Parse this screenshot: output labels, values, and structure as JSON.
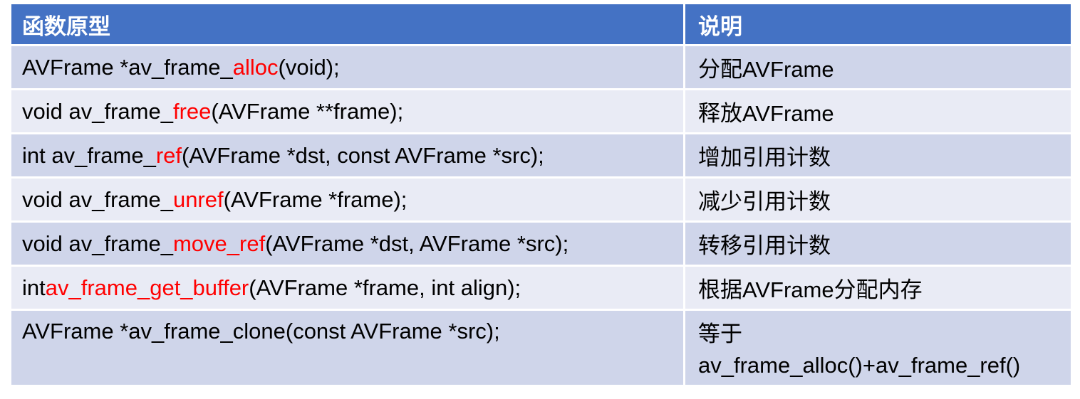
{
  "header": {
    "col1": "函数原型",
    "col2": "说明"
  },
  "rows": [
    {
      "pre": "AVFrame *av_frame_",
      "hl": "alloc",
      "post": "(void);",
      "desc": "分配AVFrame"
    },
    {
      "pre": "void av_frame_",
      "hl": "free",
      "post": "(AVFrame **frame);",
      "desc": "释放AVFrame"
    },
    {
      "pre": "int av_frame_",
      "hl": "ref",
      "post": "(AVFrame *dst, const AVFrame *src);",
      "desc": "增加引用计数"
    },
    {
      "pre": "void av_frame_",
      "hl": "unref",
      "post": "(AVFrame *frame);",
      "desc": "减少引用计数"
    },
    {
      "pre": "void av_frame_",
      "hl": "move_ref",
      "post": "(AVFrame *dst, AVFrame *src);",
      "desc": "转移引用计数"
    },
    {
      "pre": "int ",
      "hl": "av_frame_get_buffer",
      "post": "(AVFrame *frame, int align);",
      "desc": "根据AVFrame分配内存"
    },
    {
      "pre": "AVFrame *av_frame_clone(const AVFrame *src);",
      "hl": "",
      "post": "",
      "desc_line1": "等于",
      "desc_line2": "av_frame_alloc()+av_frame_ref()"
    }
  ],
  "colors": {
    "header_bg": "#4472c4",
    "row_odd_bg": "#cfd5ea",
    "row_even_bg": "#e9ebf5",
    "highlight": "#ff0000"
  }
}
